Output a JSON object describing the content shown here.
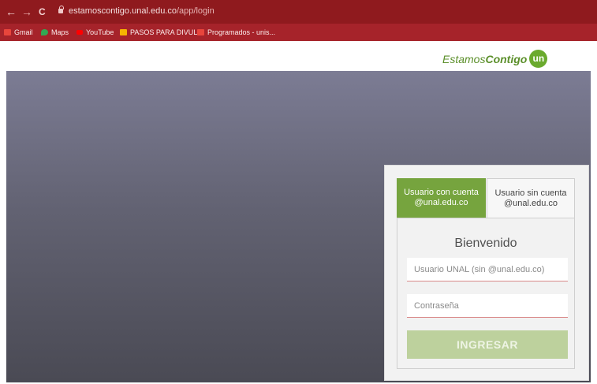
{
  "browser": {
    "url_domain": "estamoscontigo.unal.edu.co",
    "url_path": "/app/login",
    "nav": {
      "back": "←",
      "forward": "→",
      "reload": "C"
    },
    "bookmarks": [
      {
        "label": "Gmail",
        "icon": "gmail-icon",
        "color": "#e8453c"
      },
      {
        "label": "Maps",
        "icon": "maps-icon",
        "color": "#34a853"
      },
      {
        "label": "YouTube",
        "icon": "youtube-icon",
        "color": "#ff0000"
      },
      {
        "label": "PASOS PARA DIVUL...",
        "icon": "folder-icon",
        "color": "#f6b400"
      },
      {
        "label": "Programados - unis...",
        "icon": "gmail-icon",
        "color": "#e8453c"
      }
    ]
  },
  "header": {
    "brand_prefix": "Estamos",
    "brand_bold": "Contigo",
    "brand_badge": "un"
  },
  "login": {
    "tabs": [
      {
        "line1": "Usuario con cuenta",
        "line2": "@unal.edu.co",
        "active": true
      },
      {
        "line1": "Usuario sin cuenta",
        "line2": "@unal.edu.co",
        "active": false
      }
    ],
    "welcome": "Bienvenido",
    "username_placeholder": "Usuario UNAL (sin @unal.edu.co)",
    "password_placeholder": "Contraseña",
    "submit_label": "INGRESAR"
  },
  "colors": {
    "browser_chrome": "#8f1a1e",
    "brand_green": "#6aaa2e",
    "active_tab": "#76a43e",
    "button_disabled": "#bdd19d"
  }
}
